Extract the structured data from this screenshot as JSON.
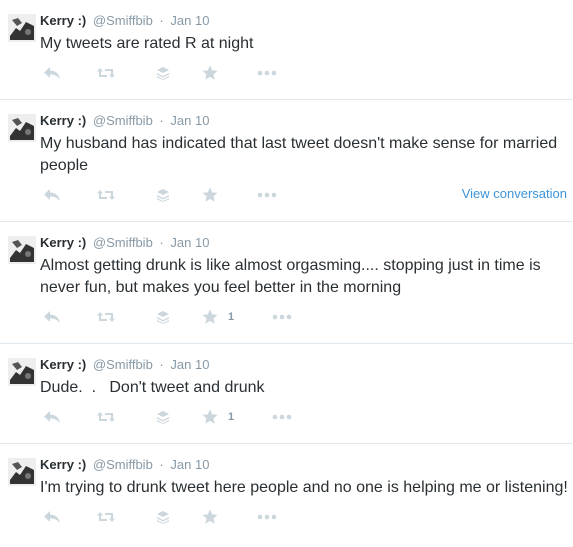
{
  "tweets": [
    {
      "fullname": "Kerry :)",
      "username": "@Smiffbib",
      "separator": "·",
      "time": "Jan 10",
      "text": "My tweets are rated R at night",
      "favorites": "",
      "view_conversation": ""
    },
    {
      "fullname": "Kerry :)",
      "username": "@Smiffbib",
      "separator": "·",
      "time": "Jan 10",
      "text": "My husband has indicated that last tweet doesn't make sense for married people",
      "favorites": "",
      "view_conversation": "View conversation"
    },
    {
      "fullname": "Kerry :)",
      "username": "@Smiffbib",
      "separator": "·",
      "time": "Jan 10",
      "text": "Almost getting drunk is like almost orgasming.... stopping just in time is never fun, but makes you feel better in the morning",
      "favorites": "1",
      "view_conversation": ""
    },
    {
      "fullname": "Kerry :)",
      "username": "@Smiffbib",
      "separator": "·",
      "time": "Jan 10",
      "text": "Dude.  .   Don't tweet and drunk",
      "favorites": "1",
      "view_conversation": ""
    },
    {
      "fullname": "Kerry :)",
      "username": "@Smiffbib",
      "separator": "·",
      "time": "Jan 10",
      "text": "I'm trying to drunk tweet here people and no one is helping me or listening!",
      "favorites": "",
      "view_conversation": ""
    }
  ],
  "icons": {
    "avatar": "avatar-photo",
    "reply": "reply-icon",
    "retweet": "retweet-icon",
    "stack": "stack-icon",
    "favorite": "star-icon",
    "more": "more-dots-icon"
  },
  "colors": {
    "text": "#292f33",
    "muted": "#8899a6",
    "icon": "#ccd6dd",
    "link": "#3b94d9",
    "divider": "#e1e8ed"
  }
}
